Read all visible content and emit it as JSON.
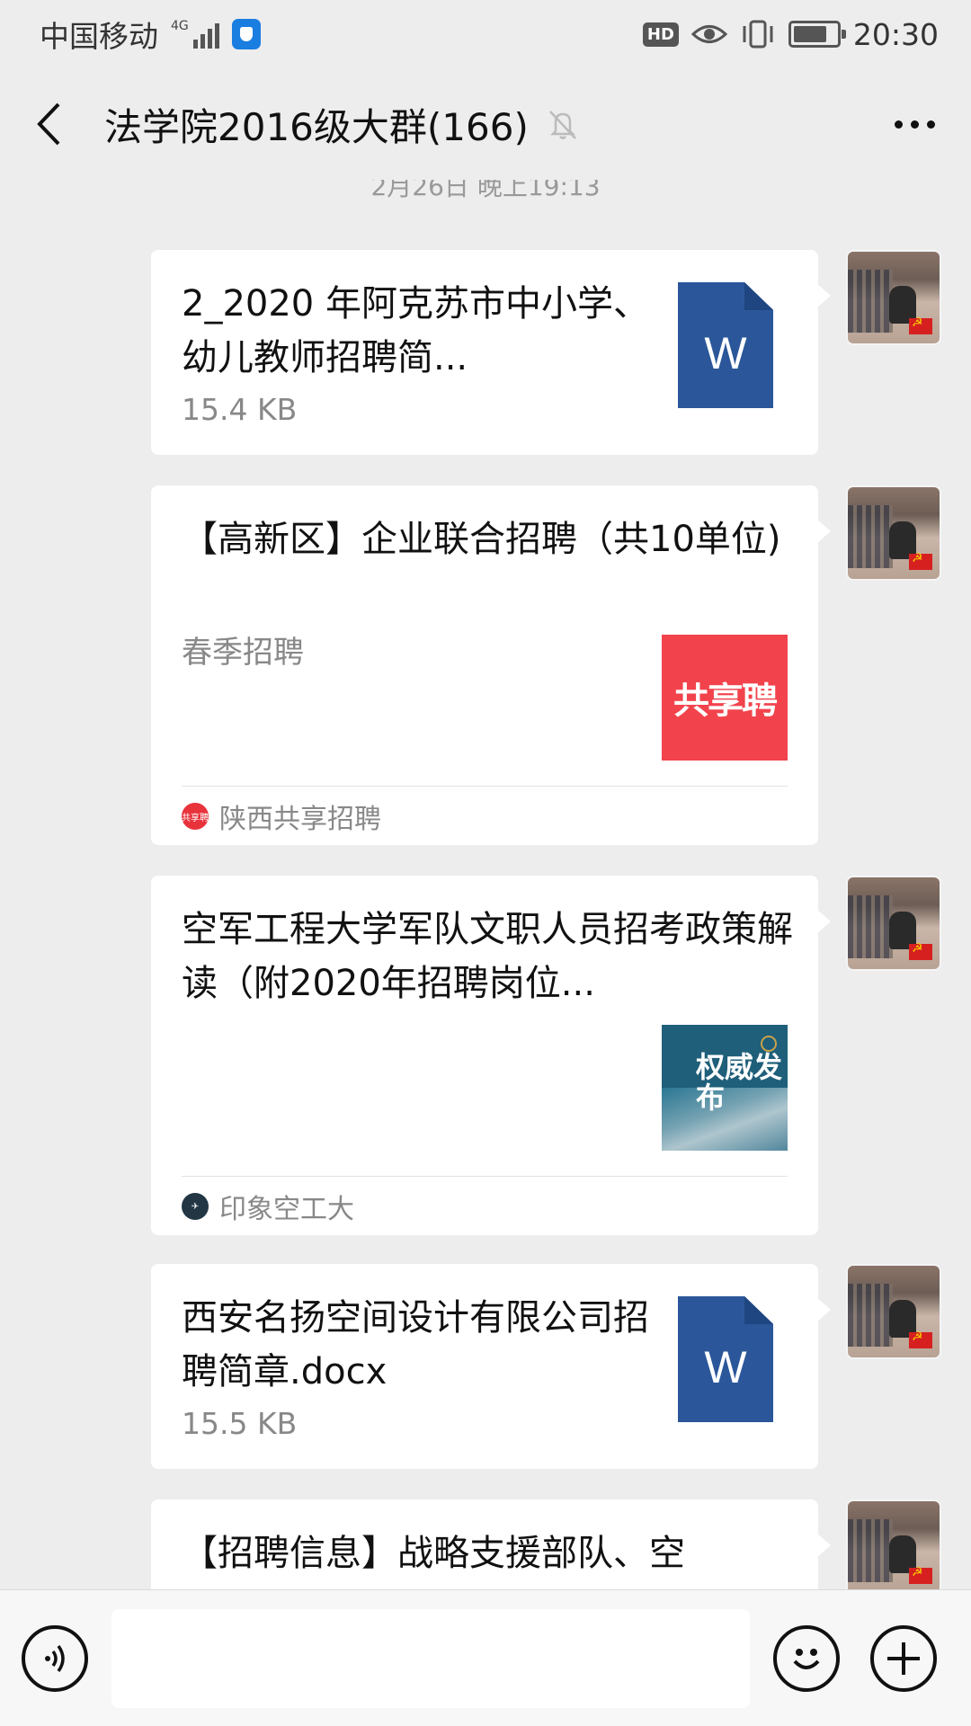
{
  "status_bar": {
    "carrier": "中国移动",
    "network": "4G",
    "hd": "HD",
    "time": "20:30"
  },
  "nav": {
    "title": "法学院2016级大群(166)"
  },
  "chat": {
    "timestamp": "2月26日 晚上19:13",
    "messages": [
      {
        "type": "file",
        "name": "2_2020 年阿克苏市中小学、幼儿教师招聘简...",
        "size": "15.4 KB",
        "icon": "W"
      },
      {
        "type": "link",
        "title": "【高新区】企业联合招聘（共10单位)",
        "desc": "春季招聘",
        "thumb_text": "共享聘",
        "source": "陕西共享招聘",
        "source_icon_text": "共享聘"
      },
      {
        "type": "link",
        "title": "空军工程大学军队文职人员招考政策解读（附2020年招聘岗位...",
        "thumb_text": "权威发布",
        "source": "印象空工大"
      },
      {
        "type": "file",
        "name": "西安名扬空间设计有限公司招聘简章.docx",
        "size": "15.5 KB",
        "icon": "W"
      },
      {
        "type": "link",
        "title": "【招聘信息】战略支援部队、空"
      }
    ]
  },
  "colors": {
    "background": "#ededed",
    "word_blue": "#2b579a",
    "share_red": "#f2434c"
  }
}
